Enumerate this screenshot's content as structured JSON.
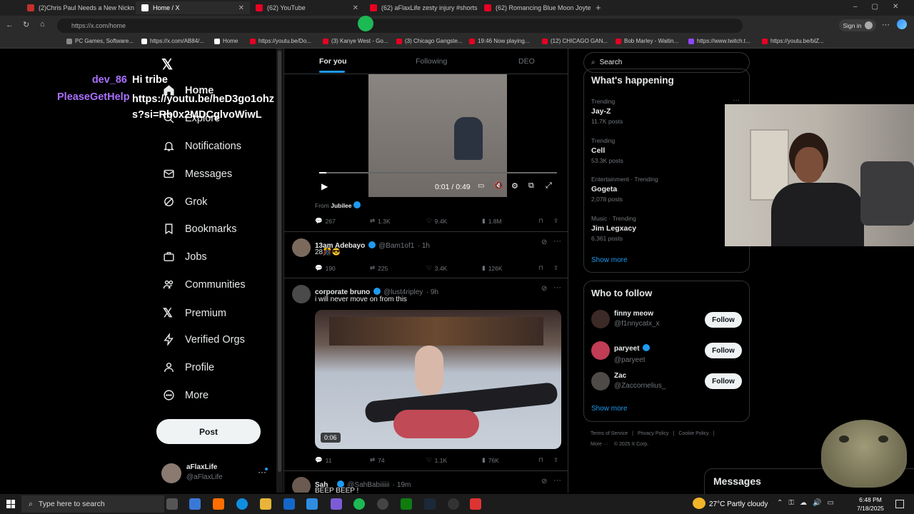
{
  "browser": {
    "tabs": [
      {
        "title": "(2)Chris Paul Needs a New Nickn",
        "color": "#c4302b"
      },
      {
        "title": "Home / X",
        "color": "#ffffff"
      },
      {
        "title": "(62) YouTube",
        "color": "#e60023"
      },
      {
        "title": "(62) aFlaxLife zesty injury #shorts",
        "color": "#e60023"
      },
      {
        "title": "(62) Romancing Blue Moon Joyte",
        "color": "#e60023"
      }
    ],
    "url": "https://x.com/home",
    "sign_in": "Sign in",
    "bookmarks": [
      "PC Games, Software...",
      "https://x.com/AB84/...",
      "Home",
      "https://youtu.be/Do...",
      "(3) Kanye West - Go...",
      "(3) Chicago Gangste...",
      "19:46 Now playing...",
      "(12) CHICAGO GAN...",
      "Bob Marley - Waitin...",
      "https://www.twitch.t...",
      "https://youtu.be/blZ..."
    ]
  },
  "nav": {
    "home": "Home",
    "explore": "Explore",
    "notifications": "Notifications",
    "messages": "Messages",
    "grok": "Grok",
    "bookmarks": "Bookmarks",
    "jobs": "Jobs",
    "communities": "Communities",
    "premium": "Premium",
    "verified_orgs": "Verified Orgs",
    "profile": "Profile",
    "more": "More",
    "post": "Post"
  },
  "account": {
    "name": "aFlaxLife",
    "handle": "@aFlaxLife"
  },
  "chat": [
    {
      "user": "dev_86",
      "message": "Hi tribe",
      "color": "#a970ff"
    },
    {
      "user": "PleaseGetHelp",
      "message": "https://youtu.be/heD3go1ohzs?si=Rb0x2MDCglvoWiwL",
      "color": "#a970ff"
    }
  ],
  "feed": {
    "tabs": [
      "For you",
      "Following",
      "DEO"
    ],
    "video1": {
      "time": "0:01 / 0:49",
      "from_label": "From",
      "from_name": "Jubilee"
    },
    "post1_stats": {
      "replies": "267",
      "reposts": "1.3K",
      "likes": "9.4K",
      "views": "1.8M"
    },
    "post2": {
      "name": "13am Adebayo",
      "handle": "@Bam1of1",
      "time": "· 1h",
      "text": "28🎊😎",
      "replies": "190",
      "reposts": "225",
      "likes": "3.4K",
      "views": "126K"
    },
    "post3": {
      "name": "corporate bruno",
      "handle": "@lust4ripley",
      "time": "· 9h",
      "text": "i will never move on from this",
      "video_time": "0:06",
      "replies": "11",
      "reposts": "74",
      "likes": "1.1K",
      "views": "76K"
    },
    "post4": {
      "name": "Sah",
      "handle": "@SahBabiiiiii",
      "time": "· 19m",
      "text": "BEEP BEEP !"
    }
  },
  "right": {
    "search_placeholder": "Search",
    "whats_happening": "What's happening",
    "trends": [
      {
        "category": "Trending",
        "name": "Jay-Z",
        "posts": "11.7K posts"
      },
      {
        "category": "Trending",
        "name": "Cell",
        "posts": "53.3K posts"
      },
      {
        "category": "Entertainment · Trending",
        "name": "Gogeta",
        "posts": "2,078 posts"
      },
      {
        "category": "Music · Trending",
        "name": "Jim Legxacy",
        "posts": "6,361 posts"
      }
    ],
    "show_more": "Show more",
    "who_to_follow": "Who to follow",
    "follow": [
      {
        "name": "finny meow",
        "handle": "@f1nnycatx_x",
        "button": "Follow"
      },
      {
        "name": "paryeet",
        "handle": "@paryeet",
        "button": "Follow"
      },
      {
        "name": "Zac",
        "handle": "@Zaccornelius_",
        "button": "Follow"
      }
    ],
    "footer": [
      "Terms of Service",
      "Privacy Policy",
      "Cookie Policy",
      "More ···",
      "© 2025 X Corp."
    ],
    "messages": "Messages"
  },
  "taskbar": {
    "search_placeholder": "Type here to search",
    "weather": "27°C  Partly cloudy",
    "time": "6:48 PM",
    "date": "7/18/2025"
  }
}
